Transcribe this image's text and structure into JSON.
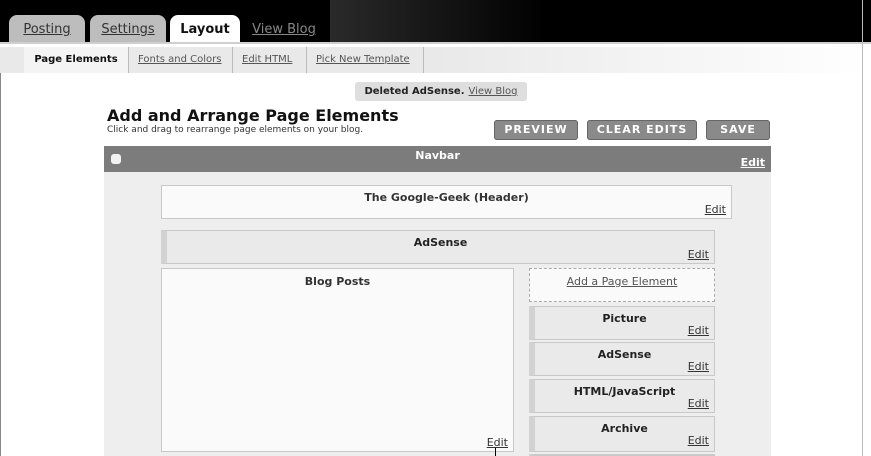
{
  "tabs": [
    {
      "label": "Posting",
      "active": false
    },
    {
      "label": "Settings",
      "active": false
    },
    {
      "label": "Layout",
      "active": true
    },
    {
      "label": "View Blog",
      "active": false
    }
  ],
  "subnav": [
    {
      "label": "Page Elements",
      "active": true
    },
    {
      "label": "Fonts and Colors",
      "active": false
    },
    {
      "label": "Edit HTML",
      "active": false
    },
    {
      "label": "Pick New Template",
      "active": false
    }
  ],
  "status": {
    "message": "Deleted AdSense.",
    "link": "View Blog"
  },
  "page": {
    "title": "Add and Arrange Page Elements",
    "subtitle": "Click and drag to rearrange page elements on your blog."
  },
  "buttons": {
    "preview": "PREVIEW",
    "clear": "CLEAR EDITS",
    "save": "SAVE"
  },
  "layout": {
    "navbar": {
      "label": "Navbar",
      "edit": "Edit"
    },
    "header": {
      "label": "The Google-Geek (Header)",
      "edit": "Edit"
    },
    "adsense_top": {
      "label": "AdSense",
      "edit": "Edit"
    },
    "blog_posts": {
      "label": "Blog Posts",
      "edit": "Edit"
    },
    "add_element": "Add a Page Element",
    "sidebar": [
      {
        "label": "Picture",
        "edit": "Edit"
      },
      {
        "label": "AdSense",
        "edit": "Edit"
      },
      {
        "label": "HTML/JavaScript",
        "edit": "Edit"
      },
      {
        "label": "Archive",
        "edit": "Edit"
      }
    ]
  },
  "colors": {
    "topbar": "#000000",
    "navbar": "#7c7c7c",
    "button": "#8a8a8a",
    "canvas": "#eeeeee"
  }
}
